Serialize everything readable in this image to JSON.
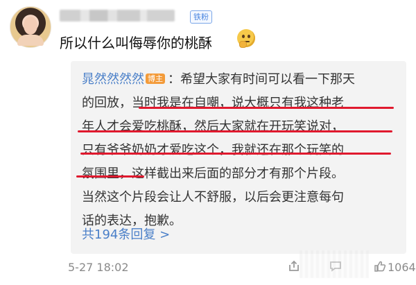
{
  "comment": {
    "badge": "铁粉",
    "text": "所以什么叫侮辱你的桃酥",
    "emoji": "thinking-face-icon"
  },
  "reply": {
    "author": "晁然然然然",
    "author_badge": "博主",
    "lines": [
      "：希望大家有时间可以看一下那天",
      "的回放，当时我是在自嘲，说大概只有我这种老",
      "年人才会爱吃桃酥，然后大家就在开玩笑说对，",
      "只有爷爷奶奶才爱吃这个，我就还在那个玩笑的",
      "氛围里，这样截出来后面的部分才有那个片段。",
      "当然这个片段会让人不舒服，以后会更注意每句",
      "话的表达，抱歉。"
    ],
    "more_replies": "共194条回复 >"
  },
  "footer": {
    "timestamp": "5-27 18:02",
    "like_count": "1064"
  },
  "colors": {
    "link_blue": "#4a7fc8",
    "underline_red": "#e0192e",
    "reply_bg": "#f3f3f3"
  }
}
